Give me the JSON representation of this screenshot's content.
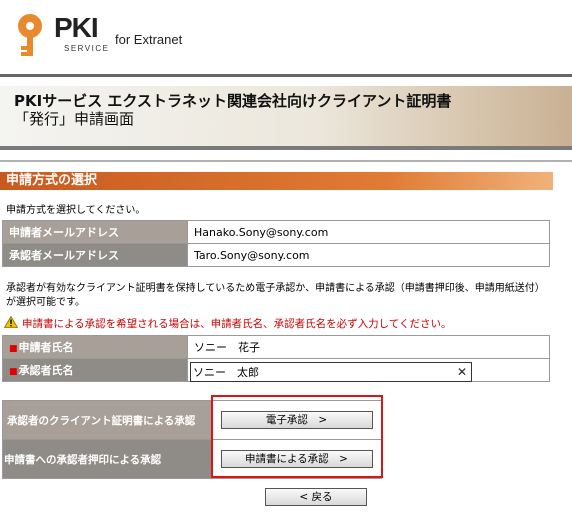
{
  "header": {
    "logo_text": "PKI",
    "logo_sub": "SERVICE",
    "tagline": "for Extranet"
  },
  "banner": {
    "title_line1": "PKIサービス エクストラネット関連会社向けクライアント証明書",
    "title_line2": "「発行」申請画面"
  },
  "section": {
    "title": "申請方式の選択",
    "instruction": "申請方式を選択してください。"
  },
  "emails": {
    "applicant_label": "申請者メールアドレス",
    "applicant_value": "Hanako.Sony@sony.com",
    "approver_label": "承認者メールアドレス",
    "approver_value": "Taro.Sony@sony.com"
  },
  "note": "承認者が有効なクライアント証明書を保持しているため電子承認か、申請書による承認（申請書押印後、申請用紙送付）が選択可能です。",
  "warning": "申請書による承認を希望される場合は、申請者氏名、承認者氏名を必ず入力してください。",
  "names": {
    "required_mark": "■",
    "applicant_label": "申請者氏名",
    "applicant_value": "ソニー　花子",
    "approver_label": "承認者氏名",
    "approver_value": "ソニー　太郎"
  },
  "approval": {
    "electronic_label": "承認者のクライアント証明書による承認",
    "electronic_button": "電子承認　>",
    "document_label": "申請書への承認者押印による承認",
    "document_button": "申請書による承認　>"
  },
  "back_button": "< 戻る",
  "colors": {
    "accent": "#d86a27",
    "label_bg": "#a8a098",
    "warning": "#cc0000",
    "highlight": "#d81818"
  },
  "icons": {
    "logo": "key-icon",
    "warning": "warning-icon",
    "clear": "close-icon"
  }
}
